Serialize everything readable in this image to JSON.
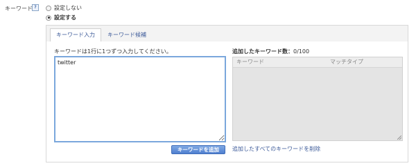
{
  "field": {
    "label": "キーワード",
    "help_icon": "?"
  },
  "options": [
    {
      "label": "設定しない",
      "selected": false
    },
    {
      "label": "設定する",
      "selected": true
    }
  ],
  "tabs": [
    {
      "label": "キーワード入力",
      "active": true
    },
    {
      "label": "キーワード候補",
      "active": false
    }
  ],
  "input": {
    "instructions": "キーワードは1行に1つずつ入力してください。",
    "value": "twitter",
    "add_button": "キーワードを追加"
  },
  "added": {
    "count_label": "追加したキーワード数：",
    "count": "0/100",
    "columns": [
      "キーワード",
      "マッチタイプ"
    ],
    "delete_all_link": "追加したすべてのキーワードを削除"
  },
  "colors": {
    "accent": "#3b5998",
    "button": "#5b8ad6",
    "focus_border": "#7aa7dc"
  }
}
